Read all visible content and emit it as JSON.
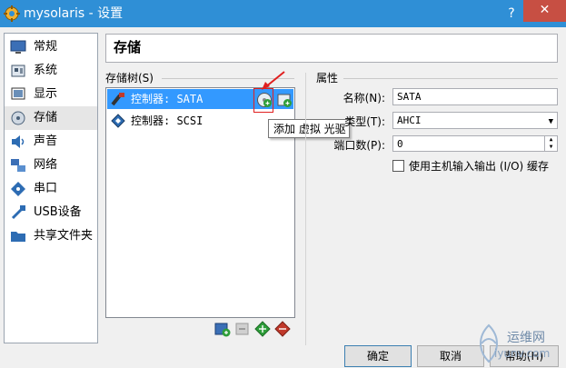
{
  "window": {
    "title": "mysolaris - 设置",
    "help_label": "?",
    "close_label": "✕"
  },
  "sidebar": {
    "items": [
      {
        "label": "常规",
        "icon": "monitor-icon"
      },
      {
        "label": "系统",
        "icon": "system-board-icon"
      },
      {
        "label": "显示",
        "icon": "display-icon"
      },
      {
        "label": "存储",
        "icon": "storage-disk-icon",
        "selected": true
      },
      {
        "label": "声音",
        "icon": "speaker-icon"
      },
      {
        "label": "网络",
        "icon": "network-icon"
      },
      {
        "label": "串口",
        "icon": "serial-port-icon"
      },
      {
        "label": "USB设备",
        "icon": "usb-icon"
      },
      {
        "label": "共享文件夹",
        "icon": "folder-icon"
      }
    ]
  },
  "page": {
    "title": "存储"
  },
  "storage_tree": {
    "group_label": "存储树(S)",
    "controllers": [
      {
        "label": "控制器: SATA",
        "selected": true
      },
      {
        "label": "控制器: SCSI",
        "selected": false
      }
    ],
    "tooltip": "添加 虚拟 光驱"
  },
  "attributes": {
    "group_label": "属性",
    "name_label": "名称(N):",
    "name_value": "SATA",
    "type_label": "类型(T):",
    "type_value": "AHCI",
    "ports_label": "端口数(P):",
    "ports_value": "0",
    "host_io_cache_label": "使用主机输入输出 (I/O) 缓存",
    "host_io_cache_checked": false
  },
  "buttons": {
    "ok": "确定",
    "cancel": "取消",
    "help": "帮助(H)"
  },
  "watermark": {
    "brand": "运维网",
    "url": "iyunv.com"
  },
  "colors": {
    "titlebar": "#2f8fd6",
    "close": "#c74f43",
    "selection": "#3399ff"
  }
}
